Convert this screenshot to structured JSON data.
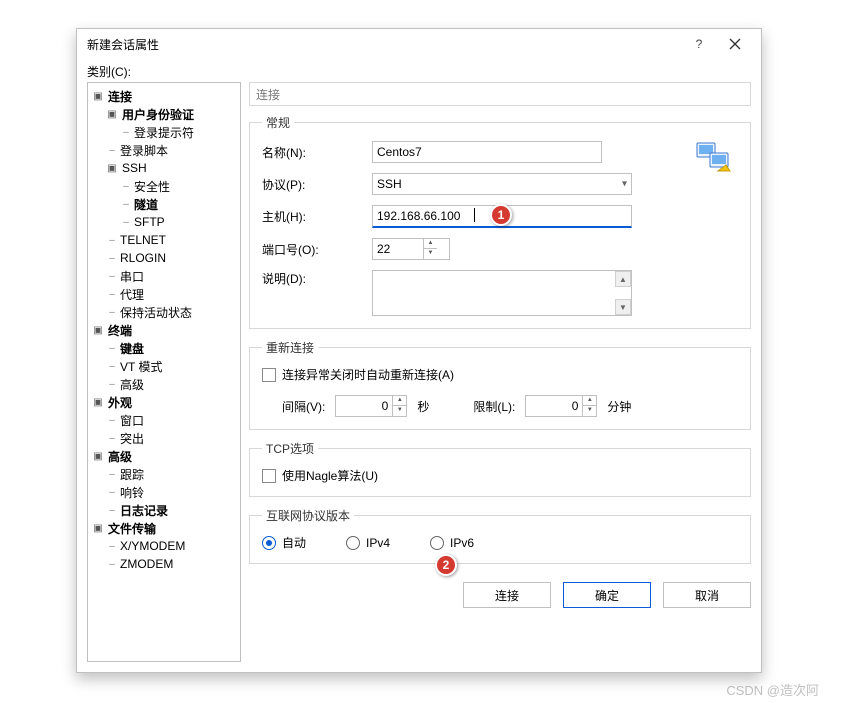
{
  "window": {
    "title": "新建会话属性",
    "help_icon": "?",
    "close_icon": "×"
  },
  "category_label": "类别(C):",
  "tree": {
    "connection": "连接",
    "user_auth": "用户身份验证",
    "login_prompt": "登录提示符",
    "login_script": "登录脚本",
    "ssh": "SSH",
    "security": "安全性",
    "tunnel": "隧道",
    "sftp": "SFTP",
    "telnet": "TELNET",
    "rlogin": "RLOGIN",
    "serial": "串口",
    "proxy": "代理",
    "keepalive": "保持活动状态",
    "terminal": "终端",
    "keyboard": "键盘",
    "vt_mode": "VT 模式",
    "advanced_term": "高级",
    "appearance": "外观",
    "window": "窗口",
    "highlight": "突出",
    "advanced": "高级",
    "trace": "跟踪",
    "bell": "响铃",
    "logging": "日志记录",
    "file_transfer": "文件传输",
    "xymodem": "X/YMODEM",
    "zmodem": "ZMODEM"
  },
  "page_title": "连接",
  "groups": {
    "general": {
      "legend": "常规",
      "name_label": "名称(N):",
      "name_value": "Centos7",
      "protocol_label": "协议(P):",
      "protocol_value": "SSH",
      "host_label": "主机(H):",
      "host_value": "192.168.66.100",
      "port_label": "端口号(O):",
      "port_value": "22",
      "desc_label": "说明(D):"
    },
    "reconnect": {
      "legend": "重新连接",
      "auto_label": "连接异常关闭时自动重新连接(A)",
      "interval_label": "间隔(V):",
      "interval_value": "0",
      "seconds_label": "秒",
      "limit_label": "限制(L):",
      "limit_value": "0",
      "minutes_label": "分钟"
    },
    "tcp": {
      "legend": "TCP选项",
      "nagle_label": "使用Nagle算法(U)"
    },
    "ipver": {
      "legend": "互联网协议版本",
      "auto": "自动",
      "ipv4": "IPv4",
      "ipv6": "IPv6"
    }
  },
  "buttons": {
    "connect": "连接",
    "ok": "确定",
    "cancel": "取消"
  },
  "badges": {
    "b1": "1",
    "b2": "2"
  },
  "watermark": "CSDN @造次阿"
}
